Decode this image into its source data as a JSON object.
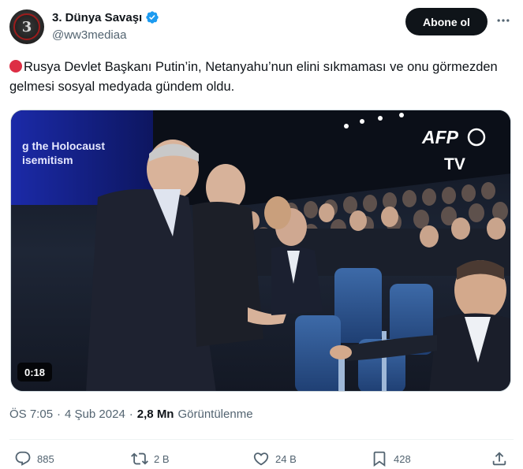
{
  "author": {
    "display_name": "3. Dünya Savaşı",
    "handle": "@ww3mediaa",
    "avatar_text": "3",
    "verified": true
  },
  "follow_button": {
    "label": "Abone ol"
  },
  "tweet": {
    "text": "Rusya Devlet Başkanı Putin’in, Netanyahu’nun elini sıkmaması ve onu görmezden gelmesi sosyal medyada gündem oldu.",
    "emoji": "red-circle-icon"
  },
  "media": {
    "overlay_text_1": "g the Holocaust",
    "overlay_text_2": "isemitism",
    "brand_top": "AFP",
    "brand_bottom": "TV",
    "duration": "0:18"
  },
  "meta": {
    "time": "ÖS 7:05",
    "separator": "·",
    "date": "4 Şub 2024",
    "views_count": "2,8 Mn",
    "views_label": "Görüntülenme"
  },
  "actions": {
    "replies": "885",
    "reposts": "2 B",
    "likes": "24 B",
    "bookmarks": "428"
  },
  "colors": {
    "primary_text": "#0f1419",
    "secondary_text": "#536471",
    "verified_blue": "#1d9bf0",
    "follow_button_bg": "#0f1419"
  }
}
